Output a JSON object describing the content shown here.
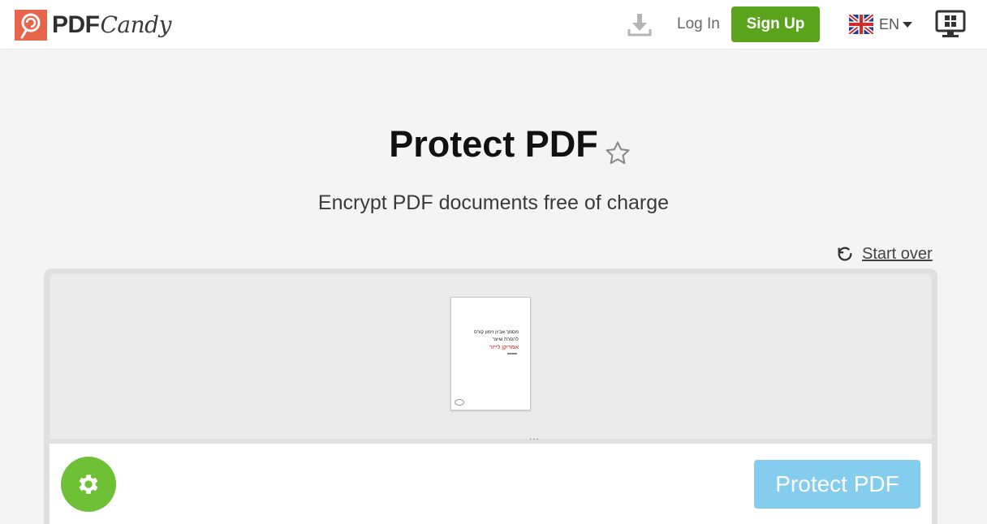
{
  "header": {
    "brand_bold": "PDF",
    "brand_script": "Candy",
    "login_label": "Log In",
    "signup_label": "Sign Up",
    "language": "EN",
    "icons": [
      "lollipop-logo-icon",
      "download-icon",
      "uk-flag-icon",
      "caret-down-icon",
      "desktop-app-icon"
    ]
  },
  "main": {
    "title": "Protect PDF",
    "subtitle": "Encrypt PDF documents free of charge",
    "start_over_label": "Start over",
    "thumb_ellipsis": "...",
    "document": {
      "line1": "מסמך אביון זימון קורס",
      "line2": "להסרת שיער",
      "line3": "אמריקן לייזר"
    },
    "protect_button_label": "Protect PDF"
  },
  "colors": {
    "brand_orange": "#e8654c",
    "signup_green": "#5aa41c",
    "settings_green": "#6ec035",
    "protect_blue_disabled": "#85cdee"
  }
}
